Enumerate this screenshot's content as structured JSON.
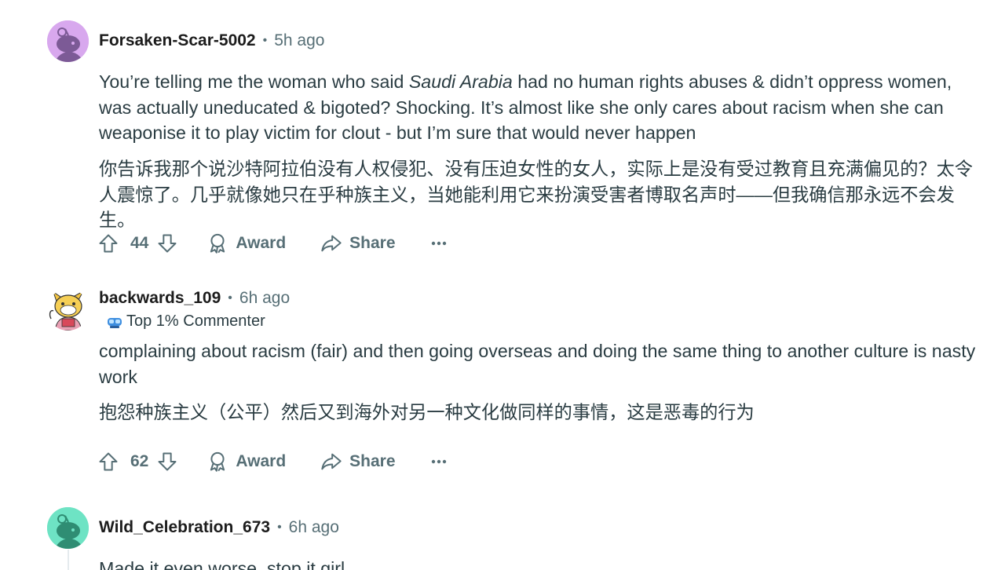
{
  "comments": [
    {
      "username": "Forsaken-Scar-5002",
      "time": "5h ago",
      "body_en_1": "You’re telling me the woman who said ",
      "body_en_em": "Saudi Arabia",
      "body_en_2": " had no human rights abuses & didn’t oppress women, was actually uneducated & bigoted? Shocking. It’s almost like she only cares about racism when she can weaponise it to play victim for clout - but I’m sure that would never happen",
      "body_zh": "你告诉我那个说沙特阿拉伯没有人权侵犯、没有压迫女性的女人，实际上是没有受过教育且充满偏见的？太令人震惊了。几乎就像她只在乎种族主义，当她能利用它来扮演受害者博取名声时——但我确信那永远不会发生。",
      "score": "44",
      "award_label": "Award",
      "share_label": "Share",
      "avatar_color": "#d8a8ee"
    },
    {
      "username": "backwards_109",
      "time": "6h ago",
      "flair": "Top 1% Commenter",
      "body_en": "complaining about racism (fair) and then going overseas and doing the same thing to another culture is nasty work",
      "body_zh": "抱怨种族主义（公平）然后又到海外对另一种文化做同样的事情，这是恶毒的行为",
      "score": "62",
      "award_label": "Award",
      "share_label": "Share"
    },
    {
      "username": "Wild_Celebration_673",
      "time": "6h ago",
      "body_en": "Made it even worse, stop it girl",
      "avatar_color": "#6ee3c4"
    }
  ],
  "colors": {
    "text_primary": "#1c1c1c",
    "text_body": "#2a3c42",
    "text_meta": "#576f76"
  },
  "icons": [
    "upvote-icon",
    "downvote-icon",
    "award-icon",
    "share-icon",
    "more-icon",
    "snoo-avatar",
    "flair-icon"
  ]
}
